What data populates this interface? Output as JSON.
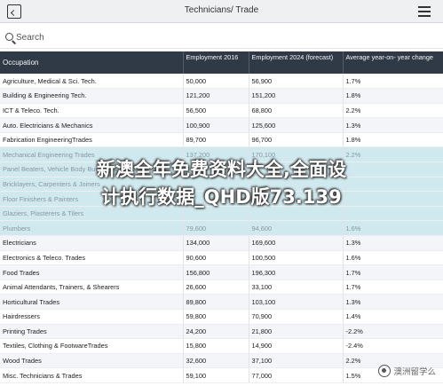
{
  "topbar": {
    "title": "Technicians/ Trade"
  },
  "search": {
    "placeholder": "Search"
  },
  "table": {
    "headers": [
      "Occupation",
      "Employment 2016",
      "Employment 2024 (forecast)",
      "Average year-on- year change"
    ],
    "rows": [
      [
        "Agriculture, Medical & Sci. Tech.",
        "50,000",
        "56,900",
        "1.7%"
      ],
      [
        "Building & Engineering Tech.",
        "121,200",
        "151,200",
        "1.8%"
      ],
      [
        "ICT & Teleco. Tech.",
        "56,500",
        "68,800",
        "2.2%"
      ],
      [
        "Auto. Electricians & Mechanics",
        "100,900",
        "125,600",
        "1.3%"
      ],
      [
        "Fabrication EngineeringTrades",
        "89,700",
        "96,700",
        "1.8%"
      ],
      [
        "Mechanical Engineering Trades",
        "137,200",
        "170,100",
        "2.2%"
      ],
      [
        "Panel Beaters, Vehicle Body Builders & Painters",
        "",
        "",
        ""
      ],
      [
        "Bricklayers, Carpenters & Joiners",
        "",
        "",
        ""
      ],
      [
        "Floor Finishers & Painters",
        "",
        "",
        ""
      ],
      [
        "Glaziers, Plasterers & Tilers",
        "",
        "",
        ""
      ],
      [
        "Plumbers",
        "79,600",
        "94,600",
        "1.6%"
      ],
      [
        "Electricians",
        "134,000",
        "169,600",
        "1.3%"
      ],
      [
        "Electronics & Teleco. Trades",
        "90,600",
        "100,500",
        "1.6%"
      ],
      [
        "Food Trades",
        "156,800",
        "196,300",
        "1.7%"
      ],
      [
        "Animal Attendants, Trainers, & Shearers",
        "26,600",
        "33,100",
        "1.7%"
      ],
      [
        "Horticultural Trades",
        "89,800",
        "103,100",
        "1.3%"
      ],
      [
        "Hairdressers",
        "59,800",
        "70,900",
        "1.4%"
      ],
      [
        "Printing Trades",
        "24,200",
        "21,800",
        "-2.2%"
      ],
      [
        "Textiles, Clothing & FootwareTrades",
        "15,800",
        "14,900",
        "-2.4%"
      ],
      [
        "Wood Trades",
        "32,600",
        "37,100",
        "2.2%"
      ],
      [
        "Misc. Technicians & Trades",
        "59,100",
        "77,000",
        "1.5%"
      ]
    ]
  },
  "overlay": {
    "line1": "新澳全年免费资料大全,全面设",
    "line2": "计执行数据_QHD版73.139"
  },
  "watermark": {
    "text": "澳洲留学么"
  }
}
